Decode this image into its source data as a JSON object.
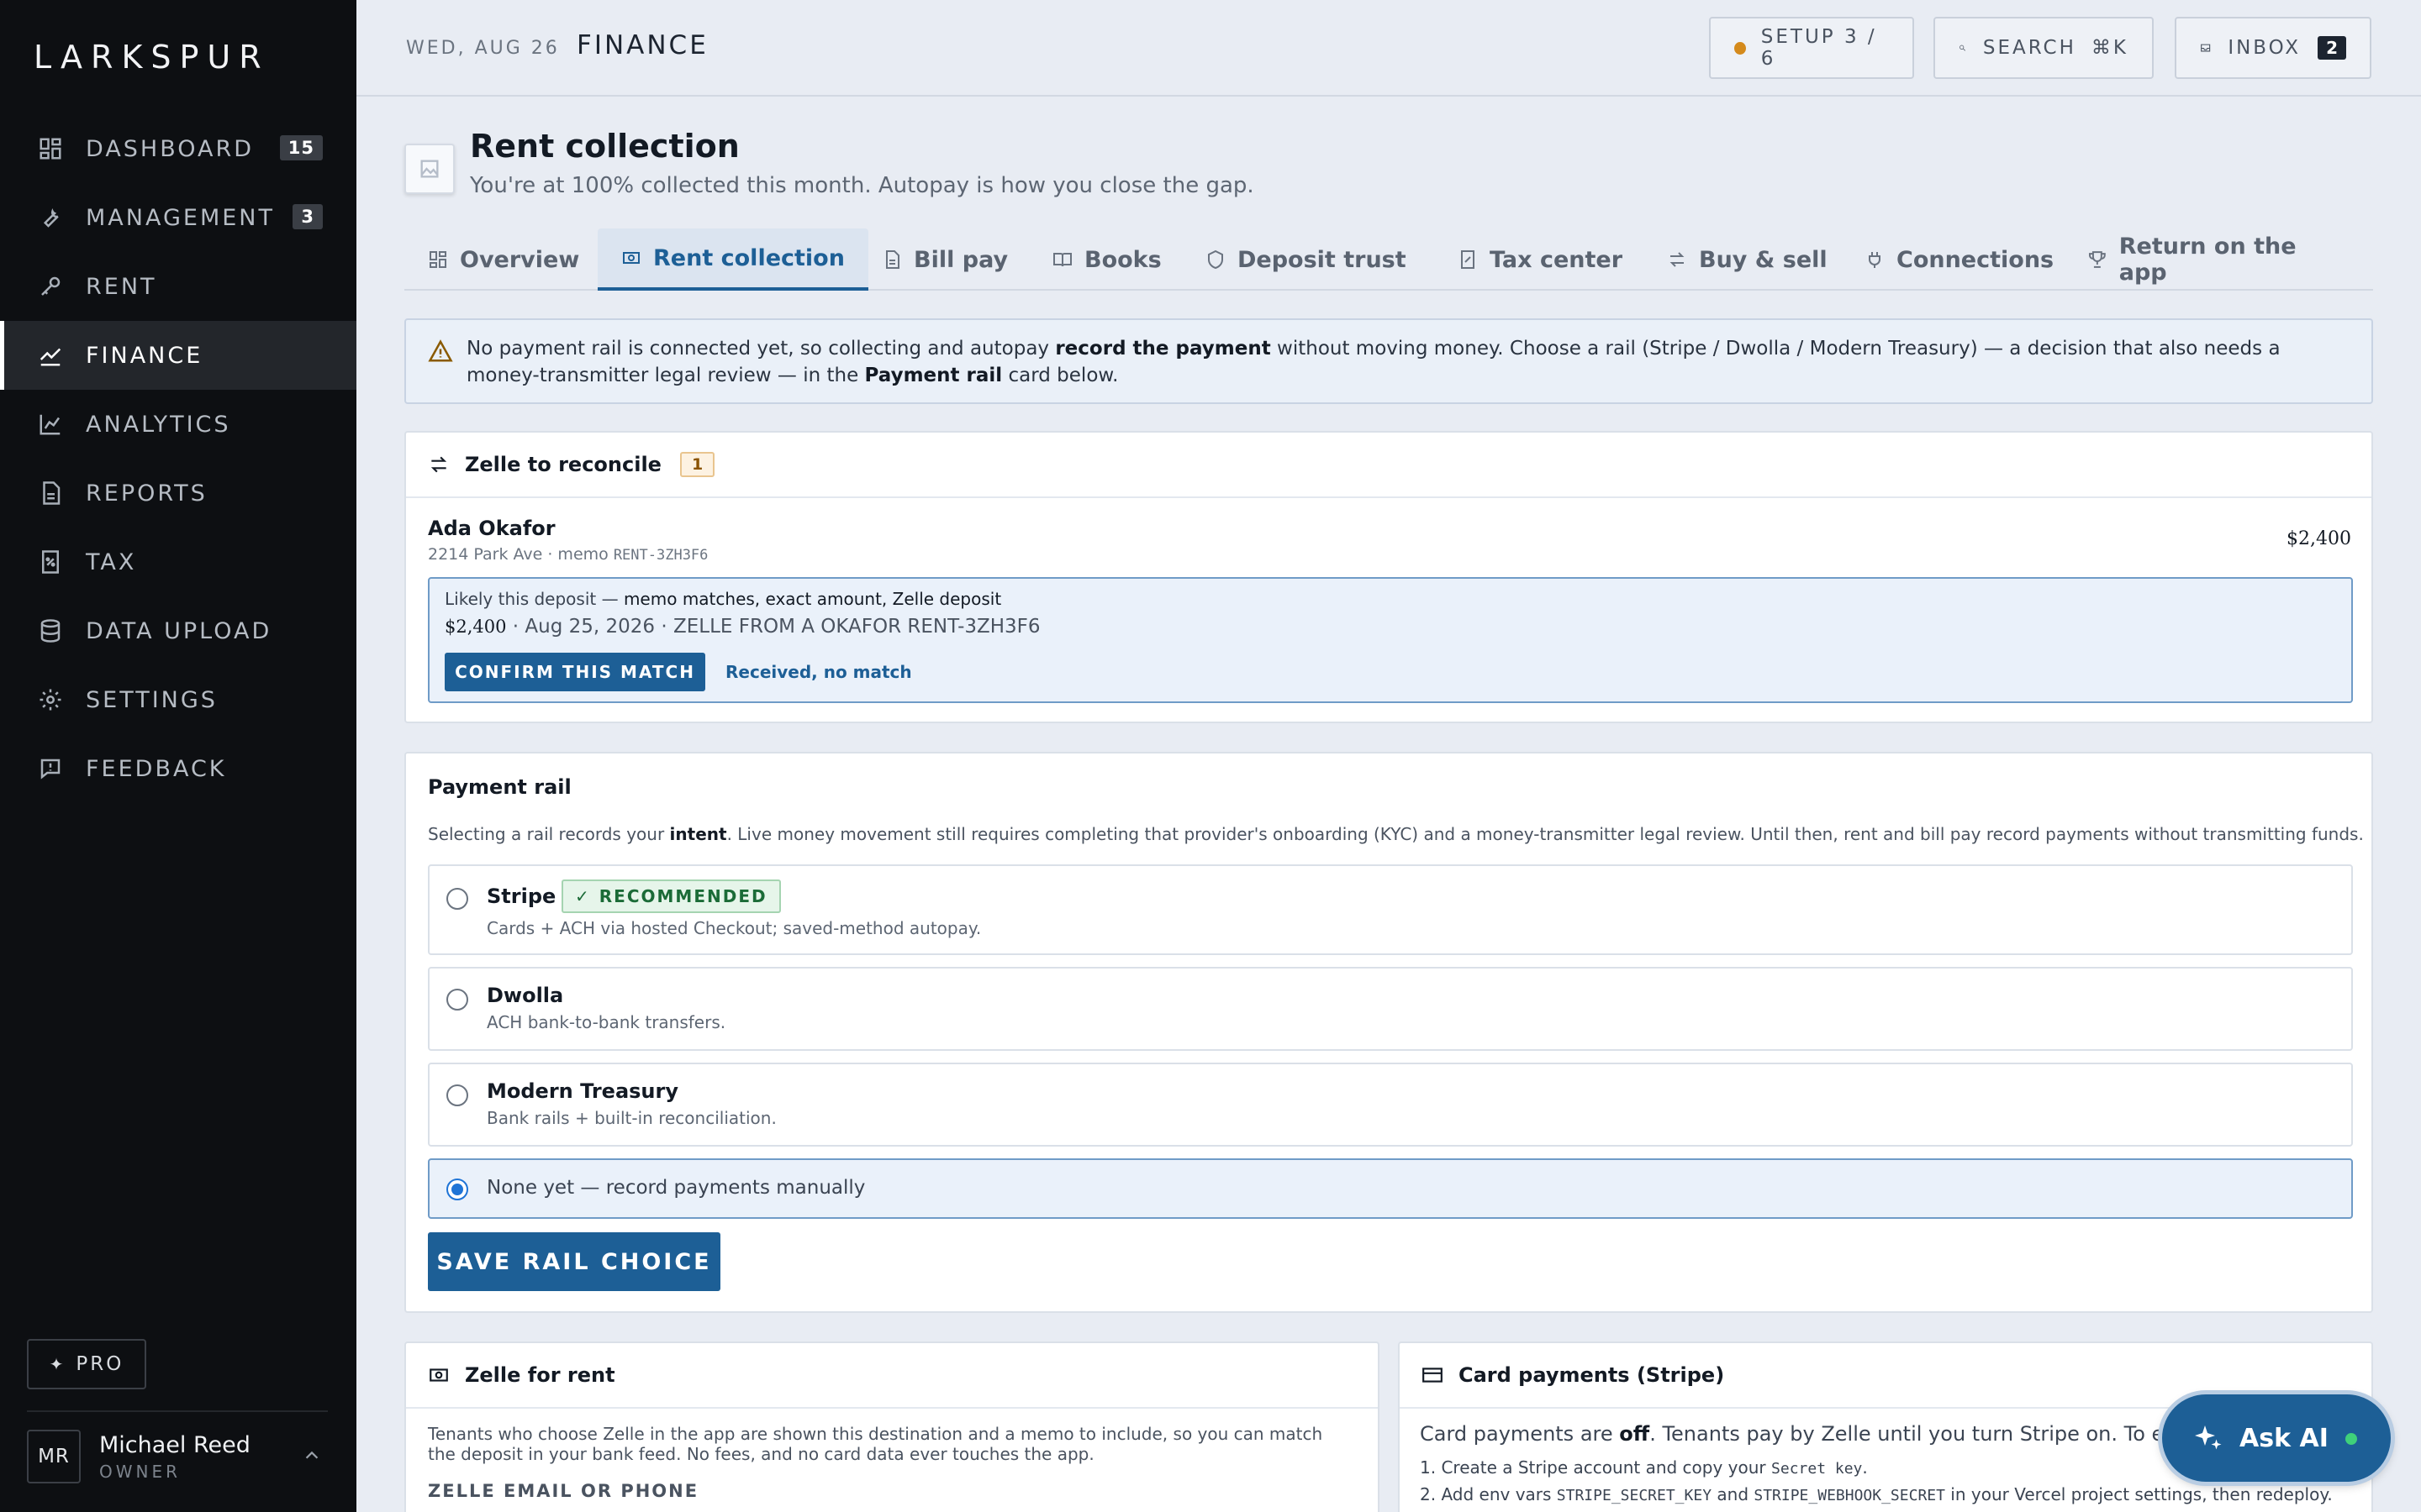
{
  "brand": "LARKSPUR",
  "nav": [
    {
      "label": "DASHBOARD",
      "icon": "dashboard-icon",
      "badge": "15"
    },
    {
      "label": "MANAGEMENT",
      "icon": "wrench-icon",
      "badge": "3"
    },
    {
      "label": "RENT",
      "icon": "key-icon",
      "badge": ""
    },
    {
      "label": "FINANCE",
      "icon": "trend-icon",
      "badge": "",
      "active": true
    },
    {
      "label": "ANALYTICS",
      "icon": "bar-chart-icon",
      "badge": ""
    },
    {
      "label": "REPORTS",
      "icon": "document-icon",
      "badge": ""
    },
    {
      "label": "TAX",
      "icon": "receipt-icon",
      "badge": ""
    },
    {
      "label": "DATA UPLOAD",
      "icon": "database-icon",
      "badge": ""
    },
    {
      "label": "SETTINGS",
      "icon": "gear-icon",
      "badge": ""
    },
    {
      "label": "FEEDBACK",
      "icon": "feedback-icon",
      "badge": ""
    }
  ],
  "pro_label": "PRO",
  "user": {
    "initials": "MR",
    "name": "Michael Reed",
    "role": "OWNER"
  },
  "topbar": {
    "date": "WED, AUG 26",
    "section": "FINANCE",
    "setup_label": "SETUP 3 / 6",
    "search_label": "SEARCH",
    "search_shortcut": "⌘K",
    "inbox_label": "INBOX",
    "inbox_count": "2"
  },
  "page": {
    "title": "Rent collection",
    "subtitle": "You're at 100% collected this month. Autopay is how you close the gap."
  },
  "tabs": [
    {
      "label": "Overview",
      "icon": "grid-icon"
    },
    {
      "label": "Rent collection",
      "icon": "money-icon",
      "active": true
    },
    {
      "label": "Bill pay",
      "icon": "bill-icon"
    },
    {
      "label": "Books",
      "icon": "book-icon"
    },
    {
      "label": "Deposit trust",
      "icon": "shield-icon"
    },
    {
      "label": "Tax center",
      "icon": "receipt-icon"
    },
    {
      "label": "Buy & sell",
      "icon": "swap-icon"
    },
    {
      "label": "Connections",
      "icon": "plug-icon"
    },
    {
      "label": "Return on the app",
      "icon": "trophy-icon"
    }
  ],
  "alert": {
    "t1": "No payment rail is connected yet, so collecting and autopay ",
    "b1": "record the payment",
    "t2": " without moving money. Choose a rail (Stripe / Dwolla / Modern Treasury) — a decision that also needs a money-transmitter legal review — in the ",
    "b2": "Payment rail",
    "t3": " card below."
  },
  "zelle_reconcile": {
    "title": "Zelle to reconcile",
    "count": "1",
    "tenant": "Ada Okafor",
    "address": "2214 Park Ave · memo ",
    "memo": "RENT-3ZH3F6",
    "amount": "$2,400",
    "likely_prefix": "Likely this deposit — ",
    "likely_reason": "memo matches, exact amount, Zelle deposit",
    "deposit_amount": "$2,400",
    "deposit_detail": " ·  Aug 25, 2026  · ZELLE FROM A OKAFOR RENT-3ZH3F6",
    "confirm_label": "CONFIRM THIS MATCH",
    "nomatch_label": "Received, no match"
  },
  "payment_rail": {
    "title": "Payment rail",
    "d1": "Selecting a rail records your ",
    "d_bold": "intent",
    "d2": ". Live money movement still requires completing that provider's onboarding (KYC) and a money-transmitter legal review. Until then, rent and bill pay record payments without transmitting funds.",
    "options": [
      {
        "name": "Stripe",
        "desc": "Cards + ACH via hosted Checkout; saved-method autopay.",
        "badge": "RECOMMENDED"
      },
      {
        "name": "Dwolla",
        "desc": "ACH bank-to-bank transfers."
      },
      {
        "name": "Modern Treasury",
        "desc": "Bank rails + built-in reconciliation."
      }
    ],
    "manual_label": "None yet — record payments manually",
    "save_label": "SAVE RAIL CHOICE"
  },
  "zelle_rent": {
    "title": "Zelle for rent",
    "text": "Tenants who choose Zelle in the app are shown this destination and a memo to include, so you can match the deposit in your bank feed. No fees, and no card data ever touches the app.",
    "field_label": "ZELLE EMAIL OR PHONE"
  },
  "card_payments": {
    "title": "Card payments (Stripe)",
    "t1": "Card payments are ",
    "b1": "off",
    "t2": ". Tenants pay by Zelle until you turn Stripe on. To enable:",
    "s1a": "1. Create a Stripe account and copy your ",
    "s1code": "Secret key",
    "s1b": ".",
    "s2a": "2. Add env vars ",
    "s2code1": "STRIPE_SECRET_KEY",
    "s2b": " and ",
    "s2code2": "STRIPE_WEBHOOK_SECRET",
    "s2c": " in your Vercel project settings, then redeploy."
  },
  "askai_label": "Ask AI"
}
